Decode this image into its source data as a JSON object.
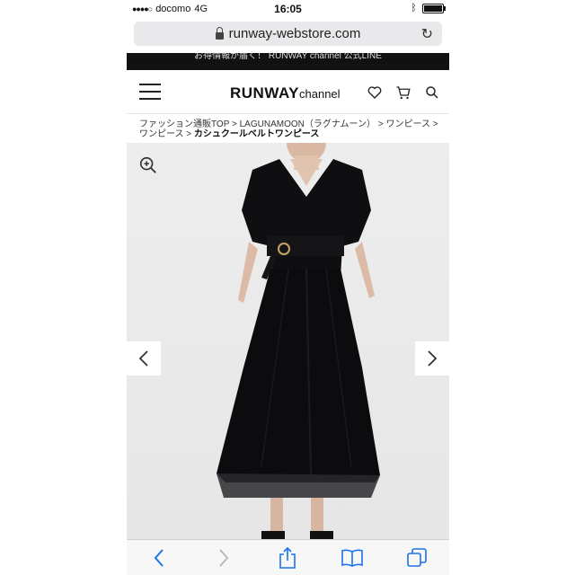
{
  "status_bar": {
    "carrier": "docomo",
    "network": "4G",
    "time": "16:05"
  },
  "browser": {
    "url": "runway-webstore.com"
  },
  "banner": {
    "text": "お得情報が届く！ RUNWAY channel 公式LINE"
  },
  "header": {
    "logo_main": "RUNWAY",
    "logo_sub": "channel"
  },
  "breadcrumb": {
    "items": [
      "ファッション通販TOP",
      "LAGUNAMOON（ラグナムーン）",
      "ワンピース",
      "ワンピース"
    ],
    "separator": " > ",
    "current": "カシュクールベルトワンピース"
  },
  "icons": {
    "menu": "hamburger-icon",
    "favorite": "heart-icon",
    "cart": "cart-icon",
    "search": "search-icon",
    "zoom": "zoom-in-icon",
    "prev": "chevron-left-icon",
    "next": "chevron-right-icon"
  },
  "colors": {
    "dress": "#0e0e10",
    "accent_blue": "#1a73e8",
    "banner_bg": "#111111"
  }
}
